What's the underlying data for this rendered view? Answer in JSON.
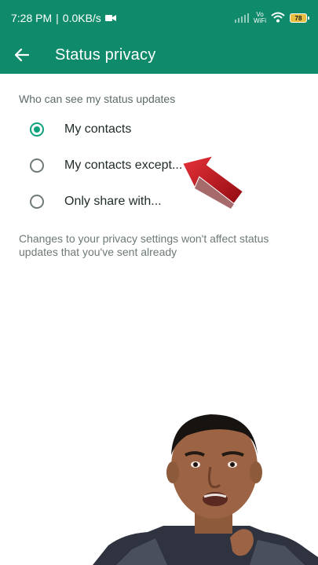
{
  "status_bar": {
    "time": "7:28 PM",
    "separator": "|",
    "data_speed": "0.0KB/s",
    "vowifi_top": "Vo",
    "vowifi_bottom": "WiFi",
    "battery": "78"
  },
  "app_bar": {
    "title": "Status privacy"
  },
  "main": {
    "section_title": "Who can see my status updates",
    "options": [
      {
        "label": "My contacts",
        "selected": true
      },
      {
        "label": "My contacts except...",
        "selected": false
      },
      {
        "label": "Only share with...",
        "selected": false
      }
    ],
    "note": "Changes to your privacy settings won't affect status updates that you've sent already"
  },
  "colors": {
    "primary": "#0f8a6a",
    "accent": "#0fa37d",
    "overlay_arrow": "#c4121a"
  },
  "icons": {
    "back": "arrow-back-icon",
    "camera": "video-camera-icon",
    "signal": "signal-icon",
    "wifi": "wifi-icon",
    "battery": "battery-icon"
  }
}
